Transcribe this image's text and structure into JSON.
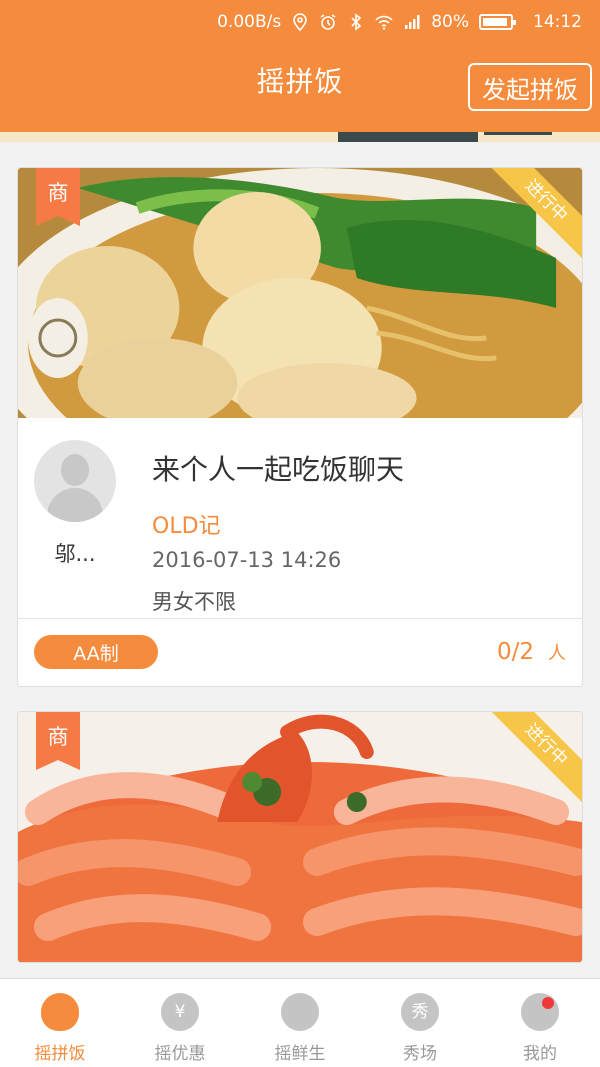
{
  "status_bar": {
    "speed": "0.00B/s",
    "battery": "80%",
    "time": "14:12"
  },
  "header": {
    "title": "摇拼饭",
    "start_button": "发起拼饭"
  },
  "cards": [
    {
      "merchant_tag": "商",
      "status": "进行中",
      "host_name": "邬...",
      "title": "来个人一起吃饭聊天",
      "restaurant": "OLD记",
      "datetime": "2016-07-13 14:26",
      "gender": "男女不限",
      "payment": "AA制",
      "count": "0/2",
      "unit": "人"
    },
    {
      "merchant_tag": "商",
      "status": "进行中"
    }
  ],
  "tabbar": [
    {
      "label": "摇拼饭",
      "icon": "rice-bowl-icon",
      "active": true
    },
    {
      "label": "摇优惠",
      "icon": "coupon-icon",
      "glyph": "¥"
    },
    {
      "label": "摇鲜生",
      "icon": "tomato-icon"
    },
    {
      "label": "秀场",
      "icon": "show-icon",
      "glyph": "秀"
    },
    {
      "label": "我的",
      "icon": "profile-icon",
      "has_badge": true
    }
  ],
  "colors": {
    "accent": "#f58b3c",
    "merchant_tag": "#f57a45",
    "status_ribbon": "#f7c548",
    "badge_dot": "#f03838"
  }
}
